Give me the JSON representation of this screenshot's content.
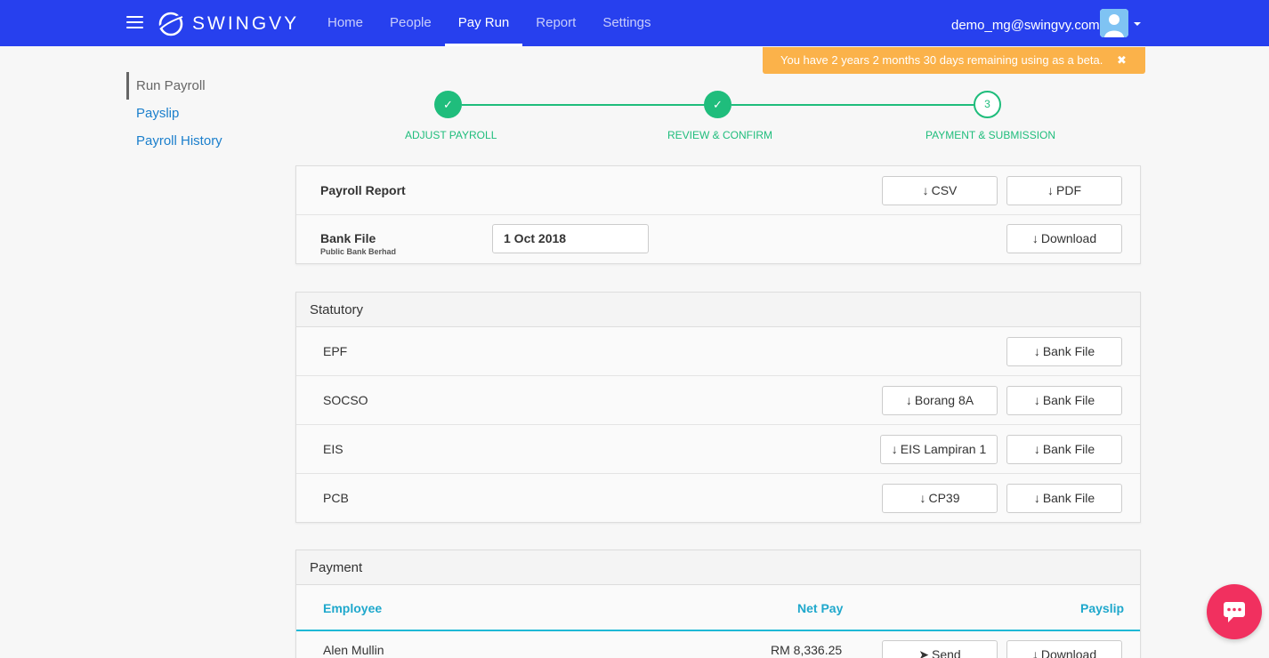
{
  "topbar": {
    "brand": "SWINGVY",
    "nav": [
      {
        "label": "Home",
        "active": false
      },
      {
        "label": "People",
        "active": false
      },
      {
        "label": "Pay Run",
        "active": true
      },
      {
        "label": "Report",
        "active": false
      },
      {
        "label": "Settings",
        "active": false
      }
    ],
    "user_email": "demo_mg@swingvy.com"
  },
  "beta_banner": {
    "text": "You have 2 years 2 months 30 days remaining using as a beta.",
    "close": "✖"
  },
  "sidebar": {
    "items": [
      {
        "label": "Run Payroll",
        "active": true
      },
      {
        "label": "Payslip",
        "active": false
      },
      {
        "label": "Payroll History",
        "active": false
      }
    ]
  },
  "stepper": {
    "steps": [
      {
        "label": "ADJUST PAYROLL",
        "state": "done",
        "mark": "✓"
      },
      {
        "label": "REVIEW & CONFIRM",
        "state": "done",
        "mark": "✓"
      },
      {
        "label": "PAYMENT & SUBMISSION",
        "state": "current",
        "mark": "3"
      }
    ]
  },
  "reports": {
    "payroll_report": {
      "label": "Payroll Report",
      "csv": "CSV",
      "pdf": "PDF"
    },
    "bank_file": {
      "label": "Bank File",
      "bank": "Public Bank Berhad",
      "date": "1 Oct 2018",
      "download": "Download"
    }
  },
  "statutory": {
    "title": "Statutory",
    "rows": [
      {
        "label": "EPF",
        "extra": "",
        "bank": "Bank File"
      },
      {
        "label": "SOCSO",
        "extra": "Borang 8A",
        "bank": "Bank File"
      },
      {
        "label": "EIS",
        "extra": "EIS Lampiran 1",
        "bank": "Bank File"
      },
      {
        "label": "PCB",
        "extra": "CP39",
        "bank": "Bank File"
      }
    ]
  },
  "payment": {
    "title": "Payment",
    "columns": {
      "employee": "Employee",
      "net_pay": "Net Pay",
      "payslip": "Payslip"
    },
    "rows": [
      {
        "name": "Alen Mullin",
        "net_pay": "RM 8,336.25",
        "send": "Send",
        "download": "Download"
      }
    ]
  },
  "colors": {
    "nav_bg": "#2740ee",
    "accent_green": "#1fbd7c",
    "banner": "#fbb24a",
    "chat": "#f1305f",
    "link": "#1b7fcc"
  }
}
